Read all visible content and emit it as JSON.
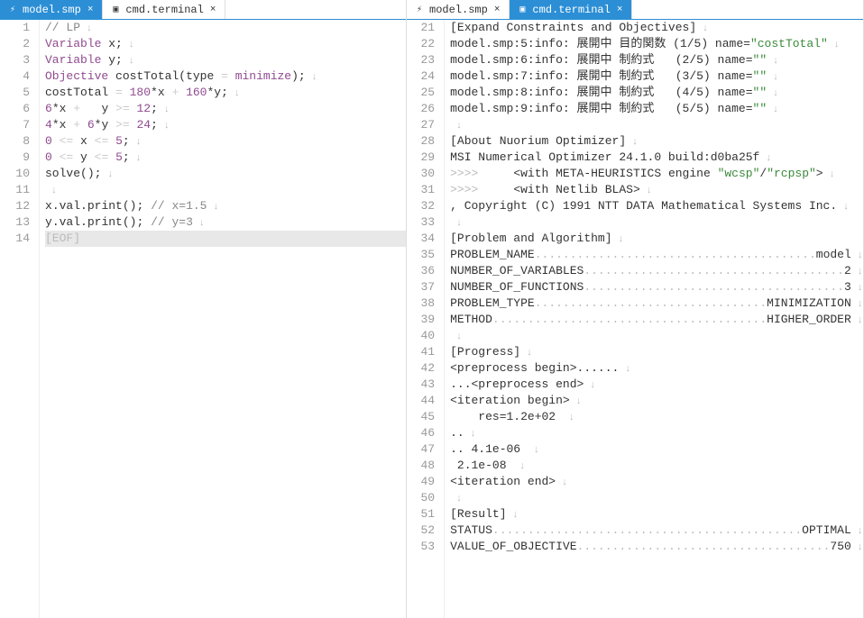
{
  "left": {
    "tabs": [
      {
        "label": "model.smp",
        "active": true,
        "icon": "⚡"
      },
      {
        "label": "cmd.terminal",
        "active": false,
        "icon": "▣"
      }
    ],
    "lines": [
      {
        "n": 1,
        "segments": [
          {
            "t": "// LP",
            "c": "comment"
          }
        ]
      },
      {
        "n": 2,
        "segments": [
          {
            "t": "Variable",
            "c": "keyword"
          },
          {
            "t": " ",
            "c": "ws"
          },
          {
            "t": "x",
            "c": "ident"
          },
          {
            "t": ";",
            "c": "punct"
          }
        ]
      },
      {
        "n": 3,
        "segments": [
          {
            "t": "Variable",
            "c": "keyword"
          },
          {
            "t": " ",
            "c": "ws"
          },
          {
            "t": "y",
            "c": "ident"
          },
          {
            "t": ";",
            "c": "punct"
          }
        ]
      },
      {
        "n": 4,
        "segments": [
          {
            "t": "Objective",
            "c": "keyword"
          },
          {
            "t": " ",
            "c": "ws"
          },
          {
            "t": "costTotal",
            "c": "ident"
          },
          {
            "t": "(",
            "c": "punct"
          },
          {
            "t": "type",
            "c": "ident"
          },
          {
            "t": " = ",
            "c": "ws"
          },
          {
            "t": "minimize",
            "c": "keyword"
          },
          {
            "t": ");",
            "c": "punct"
          }
        ]
      },
      {
        "n": 5,
        "segments": [
          {
            "t": "costTotal",
            "c": "ident"
          },
          {
            "t": " = ",
            "c": "ws"
          },
          {
            "t": "180",
            "c": "num"
          },
          {
            "t": "*",
            "c": "punct"
          },
          {
            "t": "x",
            "c": "ident"
          },
          {
            "t": " + ",
            "c": "ws"
          },
          {
            "t": "160",
            "c": "num"
          },
          {
            "t": "*",
            "c": "punct"
          },
          {
            "t": "y",
            "c": "ident"
          },
          {
            "t": ";",
            "c": "punct"
          }
        ]
      },
      {
        "n": 6,
        "segments": [
          {
            "t": "6",
            "c": "num"
          },
          {
            "t": "*",
            "c": "punct"
          },
          {
            "t": "x",
            "c": "ident"
          },
          {
            "t": " +   ",
            "c": "ws"
          },
          {
            "t": "y",
            "c": "ident"
          },
          {
            "t": " >= ",
            "c": "ws"
          },
          {
            "t": "12",
            "c": "num"
          },
          {
            "t": ";",
            "c": "punct"
          }
        ]
      },
      {
        "n": 7,
        "segments": [
          {
            "t": "4",
            "c": "num"
          },
          {
            "t": "*",
            "c": "punct"
          },
          {
            "t": "x",
            "c": "ident"
          },
          {
            "t": " + ",
            "c": "ws"
          },
          {
            "t": "6",
            "c": "num"
          },
          {
            "t": "*",
            "c": "punct"
          },
          {
            "t": "y",
            "c": "ident"
          },
          {
            "t": " >= ",
            "c": "ws"
          },
          {
            "t": "24",
            "c": "num"
          },
          {
            "t": ";",
            "c": "punct"
          }
        ]
      },
      {
        "n": 8,
        "segments": [
          {
            "t": "0",
            "c": "num"
          },
          {
            "t": " <= ",
            "c": "ws"
          },
          {
            "t": "x",
            "c": "ident"
          },
          {
            "t": " <= ",
            "c": "ws"
          },
          {
            "t": "5",
            "c": "num"
          },
          {
            "t": ";",
            "c": "punct"
          }
        ]
      },
      {
        "n": 9,
        "segments": [
          {
            "t": "0",
            "c": "num"
          },
          {
            "t": " <= ",
            "c": "ws"
          },
          {
            "t": "y",
            "c": "ident"
          },
          {
            "t": " <= ",
            "c": "ws"
          },
          {
            "t": "5",
            "c": "num"
          },
          {
            "t": ";",
            "c": "punct"
          }
        ]
      },
      {
        "n": 10,
        "segments": [
          {
            "t": "solve",
            "c": "ident"
          },
          {
            "t": "();",
            "c": "punct"
          }
        ]
      },
      {
        "n": 11,
        "segments": []
      },
      {
        "n": 12,
        "segments": [
          {
            "t": "x",
            "c": "ident"
          },
          {
            "t": ".",
            "c": "punct"
          },
          {
            "t": "val",
            "c": "ident"
          },
          {
            "t": ".",
            "c": "punct"
          },
          {
            "t": "print",
            "c": "ident"
          },
          {
            "t": "();",
            "c": "punct"
          },
          {
            "t": " ",
            "c": "ws"
          },
          {
            "t": "// x=1.5",
            "c": "comment"
          }
        ]
      },
      {
        "n": 13,
        "segments": [
          {
            "t": "y",
            "c": "ident"
          },
          {
            "t": ".",
            "c": "punct"
          },
          {
            "t": "val",
            "c": "ident"
          },
          {
            "t": ".",
            "c": "punct"
          },
          {
            "t": "print",
            "c": "ident"
          },
          {
            "t": "();",
            "c": "punct"
          },
          {
            "t": " ",
            "c": "ws"
          },
          {
            "t": "// y=3",
            "c": "comment"
          }
        ]
      },
      {
        "n": 14,
        "segments": [
          {
            "t": "[EOF]",
            "c": "eof"
          }
        ],
        "current": true,
        "noeol": true
      }
    ]
  },
  "right": {
    "tabs": [
      {
        "label": "model.smp",
        "active": false,
        "icon": "⚡"
      },
      {
        "label": "cmd.terminal",
        "active": true,
        "icon": "▣"
      }
    ],
    "lines": [
      {
        "n": 21,
        "segments": [
          {
            "t": "[Expand Constraints and Objectives]",
            "c": "term"
          }
        ]
      },
      {
        "n": 22,
        "segments": [
          {
            "t": "model.smp:5:info: 展開中 目的関数 (1/5) name=",
            "c": "term"
          },
          {
            "t": "\"costTotal\"",
            "c": "str"
          }
        ]
      },
      {
        "n": 23,
        "segments": [
          {
            "t": "model.smp:6:info: 展開中 制約式   (2/5) name=",
            "c": "term"
          },
          {
            "t": "\"\"",
            "c": "str"
          }
        ]
      },
      {
        "n": 24,
        "segments": [
          {
            "t": "model.smp:7:info: 展開中 制約式   (3/5) name=",
            "c": "term"
          },
          {
            "t": "\"\"",
            "c": "str"
          }
        ]
      },
      {
        "n": 25,
        "segments": [
          {
            "t": "model.smp:8:info: 展開中 制約式   (4/5) name=",
            "c": "term"
          },
          {
            "t": "\"\"",
            "c": "str"
          }
        ]
      },
      {
        "n": 26,
        "segments": [
          {
            "t": "model.smp:9:info: 展開中 制約式   (5/5) name=",
            "c": "term"
          },
          {
            "t": "\"\"",
            "c": "str"
          }
        ]
      },
      {
        "n": 27,
        "segments": []
      },
      {
        "n": 28,
        "segments": [
          {
            "t": "[About Nuorium Optimizer]",
            "c": "term"
          }
        ]
      },
      {
        "n": 29,
        "segments": [
          {
            "t": "MSI Numerical Optimizer 24.1.0 build:d0ba25f",
            "c": "term"
          }
        ]
      },
      {
        "n": 30,
        "segments": [
          {
            "t": "     <with META-HEURISTICS engine ",
            "c": "term"
          },
          {
            "t": "\"wcsp\"",
            "c": "str"
          },
          {
            "t": "/",
            "c": "term"
          },
          {
            "t": "\"rcpsp\"",
            "c": "str"
          },
          {
            "t": ">",
            "c": "term"
          }
        ],
        "prefix": ">>>>"
      },
      {
        "n": 31,
        "segments": [
          {
            "t": "     <with Netlib BLAS>",
            "c": "term"
          }
        ],
        "prefix": ">>>>"
      },
      {
        "n": 32,
        "segments": [
          {
            "t": ", Copyright (C) 1991 NTT DATA Mathematical Systems Inc.",
            "c": "term"
          }
        ]
      },
      {
        "n": 33,
        "segments": []
      },
      {
        "n": 34,
        "segments": [
          {
            "t": "[Problem and Algorithm]",
            "c": "term"
          }
        ]
      },
      {
        "n": 35,
        "segments": [
          {
            "t": "PROBLEM_NAME",
            "c": "term"
          },
          {
            "t": "........................................",
            "c": "dots"
          },
          {
            "t": "model",
            "c": "term"
          }
        ]
      },
      {
        "n": 36,
        "segments": [
          {
            "t": "NUMBER_OF_VARIABLES",
            "c": "term"
          },
          {
            "t": ".....................................",
            "c": "dots"
          },
          {
            "t": "2",
            "c": "term"
          }
        ]
      },
      {
        "n": 37,
        "segments": [
          {
            "t": "NUMBER_OF_FUNCTIONS",
            "c": "term"
          },
          {
            "t": ".....................................",
            "c": "dots"
          },
          {
            "t": "3",
            "c": "term"
          }
        ]
      },
      {
        "n": 38,
        "segments": [
          {
            "t": "PROBLEM_TYPE",
            "c": "term"
          },
          {
            "t": ".................................",
            "c": "dots"
          },
          {
            "t": "MINIMIZATION",
            "c": "term"
          }
        ]
      },
      {
        "n": 39,
        "segments": [
          {
            "t": "METHOD",
            "c": "term"
          },
          {
            "t": ".......................................",
            "c": "dots"
          },
          {
            "t": "HIGHER_ORDER",
            "c": "term"
          }
        ]
      },
      {
        "n": 40,
        "segments": []
      },
      {
        "n": 41,
        "segments": [
          {
            "t": "[Progress]",
            "c": "term"
          }
        ]
      },
      {
        "n": 42,
        "segments": [
          {
            "t": "<preprocess begin>......",
            "c": "term"
          }
        ]
      },
      {
        "n": 43,
        "segments": [
          {
            "t": "...<preprocess end>",
            "c": "term"
          }
        ]
      },
      {
        "n": 44,
        "segments": [
          {
            "t": "<iteration begin>",
            "c": "term"
          }
        ]
      },
      {
        "n": 45,
        "segments": [
          {
            "t": "    res=1.2e+02 ",
            "c": "term"
          }
        ]
      },
      {
        "n": 46,
        "segments": [
          {
            "t": "..",
            "c": "term"
          }
        ]
      },
      {
        "n": 47,
        "segments": [
          {
            "t": ".. 4.1e-06 ",
            "c": "term"
          }
        ]
      },
      {
        "n": 48,
        "segments": [
          {
            "t": " 2.1e-08 ",
            "c": "term"
          }
        ]
      },
      {
        "n": 49,
        "segments": [
          {
            "t": "<iteration end>",
            "c": "term"
          }
        ]
      },
      {
        "n": 50,
        "segments": []
      },
      {
        "n": 51,
        "segments": [
          {
            "t": "[Result]",
            "c": "term"
          }
        ]
      },
      {
        "n": 52,
        "segments": [
          {
            "t": "STATUS",
            "c": "term"
          },
          {
            "t": "............................................",
            "c": "dots"
          },
          {
            "t": "OPTIMAL",
            "c": "term"
          }
        ]
      },
      {
        "n": 53,
        "segments": [
          {
            "t": "VALUE_OF_OBJECTIVE",
            "c": "term"
          },
          {
            "t": "....................................",
            "c": "dots"
          },
          {
            "t": "750",
            "c": "term"
          }
        ]
      }
    ]
  },
  "eol_glyph": "↓",
  "close_glyph": "×"
}
